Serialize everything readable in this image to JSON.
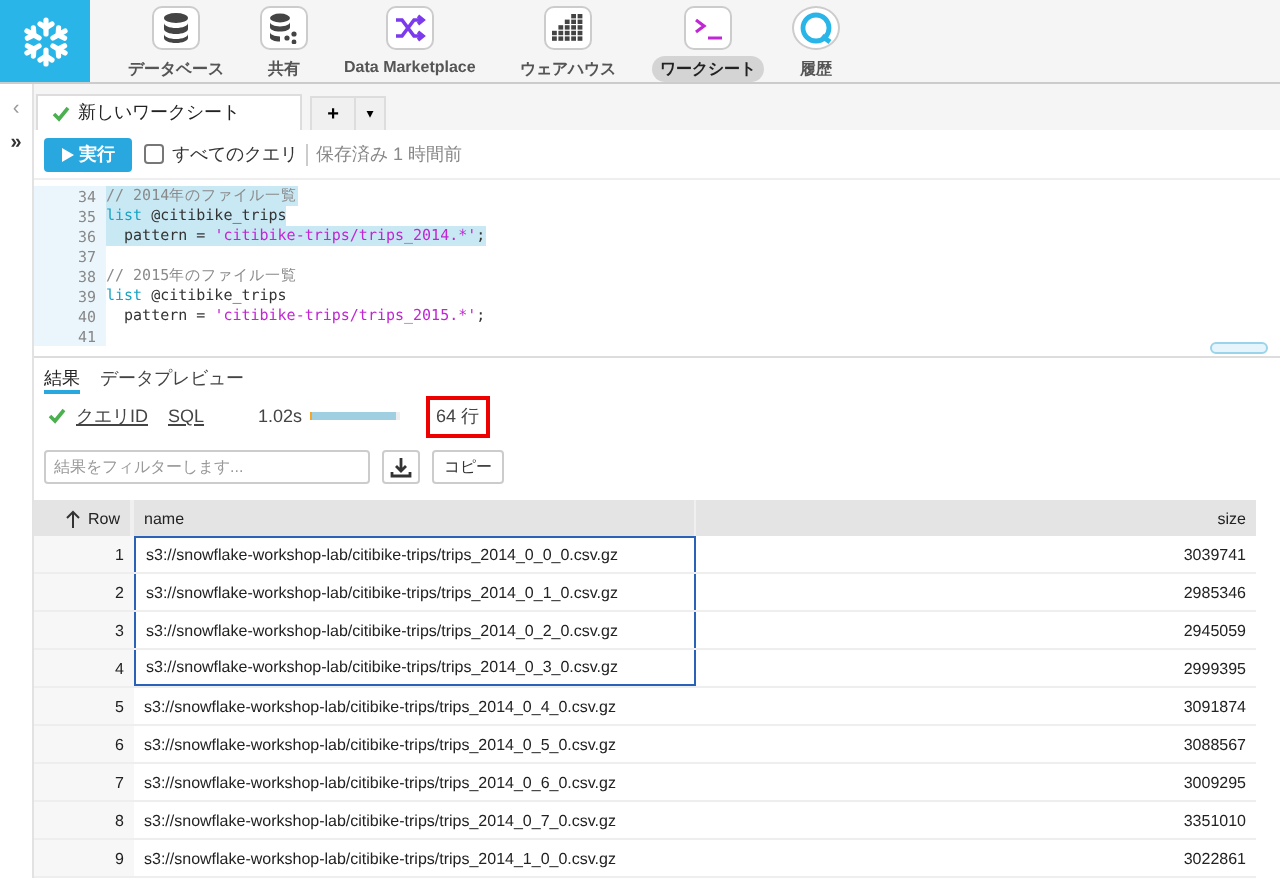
{
  "nav": {
    "items": [
      {
        "label": "データベース",
        "selected": false
      },
      {
        "label": "共有",
        "selected": false
      },
      {
        "label": "Data Marketplace",
        "selected": false
      },
      {
        "label": "ウェアハウス",
        "selected": false
      },
      {
        "label": "ワークシート",
        "selected": true
      },
      {
        "label": "履歴",
        "selected": false
      }
    ]
  },
  "sidebar": {
    "collapse": "‹",
    "expand": "»"
  },
  "worksheet_tab": {
    "title": "新しいワークシート",
    "saved": true
  },
  "tab_actions": {
    "add": "+",
    "menu": "▾"
  },
  "run_bar": {
    "run_button": "実行",
    "all_queries": {
      "label": "すべてのクエリ",
      "checked": false
    },
    "save_status": "保存済み 1 時間前"
  },
  "editor": {
    "lines": [
      {
        "number": "34",
        "selected": true,
        "tokens": [
          {
            "kind": "comment",
            "text": "// 2014年のファイル一覧"
          }
        ]
      },
      {
        "number": "35",
        "selected": true,
        "tokens": [
          {
            "kind": "keyword",
            "text": "list"
          },
          {
            "kind": "plain",
            "text": " @citibike_trips"
          }
        ]
      },
      {
        "number": "36",
        "selected": true,
        "tokens": [
          {
            "kind": "plain",
            "text": "  pattern = "
          },
          {
            "kind": "string",
            "text": "'citibike-trips/trips_2014.*'"
          },
          {
            "kind": "plain",
            "text": ";"
          }
        ]
      },
      {
        "number": "37"
      },
      {
        "number": "38",
        "selected": false,
        "tokens": [
          {
            "kind": "comment",
            "text": "// 2015年のファイル一覧"
          }
        ]
      },
      {
        "number": "39",
        "selected": false,
        "tokens": [
          {
            "kind": "keyword",
            "text": "list"
          },
          {
            "kind": "plain",
            "text": " @citibike_trips"
          }
        ]
      },
      {
        "number": "40",
        "selected": false,
        "tokens": [
          {
            "kind": "plain",
            "text": "  pattern = "
          },
          {
            "kind": "string",
            "text": "'citibike-trips/trips_2015.*'"
          },
          {
            "kind": "plain",
            "text": ";"
          }
        ]
      },
      {
        "number": "41"
      }
    ]
  },
  "result_tabs": [
    {
      "label": "結果",
      "selected": true
    },
    {
      "label": "データプレビュー",
      "selected": false
    }
  ],
  "query_info": {
    "status_ok": true,
    "query_id": "クエリID",
    "sql": "SQL",
    "duration": "1.02s",
    "level": 0.95,
    "row_count": "64 行",
    "row_count_marked": true
  },
  "filter": {
    "placeholder": "結果をフィルターします..."
  },
  "copy_button": "コピー",
  "table": {
    "columns": [
      "Row",
      "name",
      "size"
    ],
    "sort_ascending": true,
    "rows": [
      {
        "row": "1",
        "name": "s3://snowflake-workshop-lab/citibike-trips/trips_2014_0_0_0.csv.gz",
        "size": "3039741",
        "selected": true
      },
      {
        "row": "2",
        "name": "s3://snowflake-workshop-lab/citibike-trips/trips_2014_0_1_0.csv.gz",
        "size": "2985346",
        "selected": true
      },
      {
        "row": "3",
        "name": "s3://snowflake-workshop-lab/citibike-trips/trips_2014_0_2_0.csv.gz",
        "size": "2945059",
        "selected": true
      },
      {
        "row": "4",
        "name": "s3://snowflake-workshop-lab/citibike-trips/trips_2014_0_3_0.csv.gz",
        "size": "2999395",
        "selected": true
      },
      {
        "row": "5",
        "name": "s3://snowflake-workshop-lab/citibike-trips/trips_2014_0_4_0.csv.gz",
        "size": "3091874",
        "selected": false
      },
      {
        "row": "6",
        "name": "s3://snowflake-workshop-lab/citibike-trips/trips_2014_0_5_0.csv.gz",
        "size": "3088567",
        "selected": false
      },
      {
        "row": "7",
        "name": "s3://snowflake-workshop-lab/citibike-trips/trips_2014_0_6_0.csv.gz",
        "size": "3009295",
        "selected": false
      },
      {
        "row": "8",
        "name": "s3://snowflake-workshop-lab/citibike-trips/trips_2014_0_7_0.csv.gz",
        "size": "3351010",
        "selected": false
      },
      {
        "row": "9",
        "name": "s3://snowflake-workshop-lab/citibike-trips/trips_2014_1_0_0.csv.gz",
        "size": "3022861",
        "selected": false
      }
    ]
  }
}
